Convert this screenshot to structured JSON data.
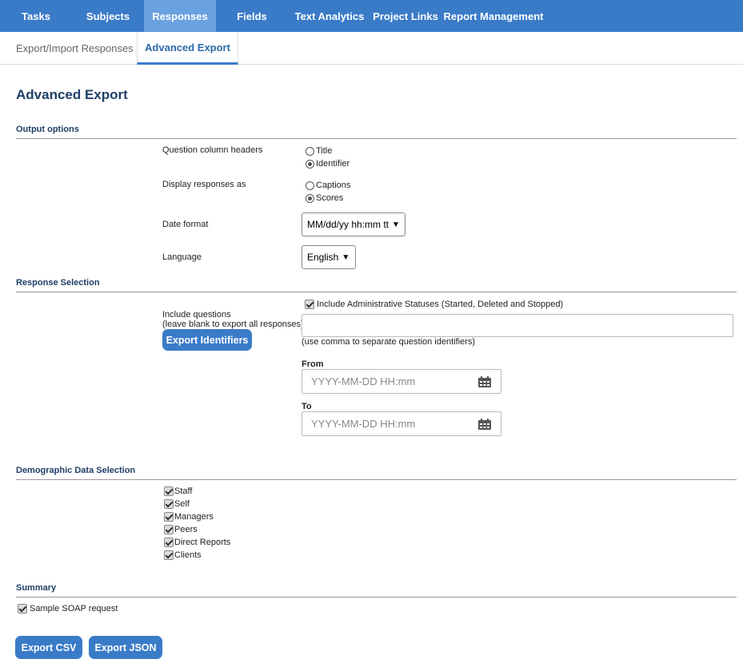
{
  "nav": {
    "items": [
      {
        "label": "Tasks",
        "active": false
      },
      {
        "label": "Subjects",
        "active": false
      },
      {
        "label": "Responses",
        "active": true
      },
      {
        "label": "Fields",
        "active": false
      },
      {
        "label": "Text Analytics",
        "active": false
      },
      {
        "label": "Project Links",
        "active": false
      },
      {
        "label": "Report Management",
        "active": false
      }
    ]
  },
  "subtabs": [
    {
      "label": "Export/Import Responses",
      "active": false
    },
    {
      "label": "Advanced Export",
      "active": true
    }
  ],
  "page_title": "Advanced Export",
  "output_options": {
    "title": "Output options",
    "column_headers": {
      "label": "Question column headers",
      "options": [
        "Title",
        "Identifier"
      ],
      "selected": "Identifier"
    },
    "display_as": {
      "label": "Display responses as",
      "options": [
        "Captions",
        "Scores"
      ],
      "selected": "Scores"
    },
    "date_format": {
      "label": "Date format",
      "value": "MM/dd/yy hh:mm tt"
    },
    "language": {
      "label": "Language",
      "value": "English"
    }
  },
  "response_selection": {
    "title": "Response Selection",
    "admin_statuses": {
      "label": "Include Administrative Statuses (Started, Deleted and Stopped)",
      "checked": true
    },
    "include_questions": {
      "label": "Include questions",
      "hint": "(leave blank to export all responses)",
      "value": "",
      "help": "(use comma to separate question identifiers)"
    },
    "export_identifiers_button": "Export Identifiers",
    "from": {
      "label": "From",
      "placeholder": "YYYY-MM-DD HH:mm"
    },
    "to": {
      "label": "To",
      "placeholder": "YYYY-MM-DD HH:mm"
    }
  },
  "demographic": {
    "title": "Demographic Data Selection",
    "items": [
      {
        "label": "Staff",
        "checked": true
      },
      {
        "label": "Self",
        "checked": true
      },
      {
        "label": "Managers",
        "checked": true
      },
      {
        "label": "Peers",
        "checked": true
      },
      {
        "label": "Direct Reports",
        "checked": true
      },
      {
        "label": "Clients",
        "checked": true
      }
    ]
  },
  "summary": {
    "title": "Summary",
    "soap": {
      "label": "Sample SOAP request",
      "checked": true
    }
  },
  "actions": {
    "export_csv": "Export CSV",
    "export_json": "Export JSON"
  },
  "colors": {
    "nav_bg": "#3a7bc8",
    "nav_active": "#6aa1e0",
    "heading": "#1f3f66",
    "button": "#3a7bc8"
  },
  "icons": {
    "calendar": "calendar-icon",
    "checkbox": "checkbox-checked-icon"
  }
}
